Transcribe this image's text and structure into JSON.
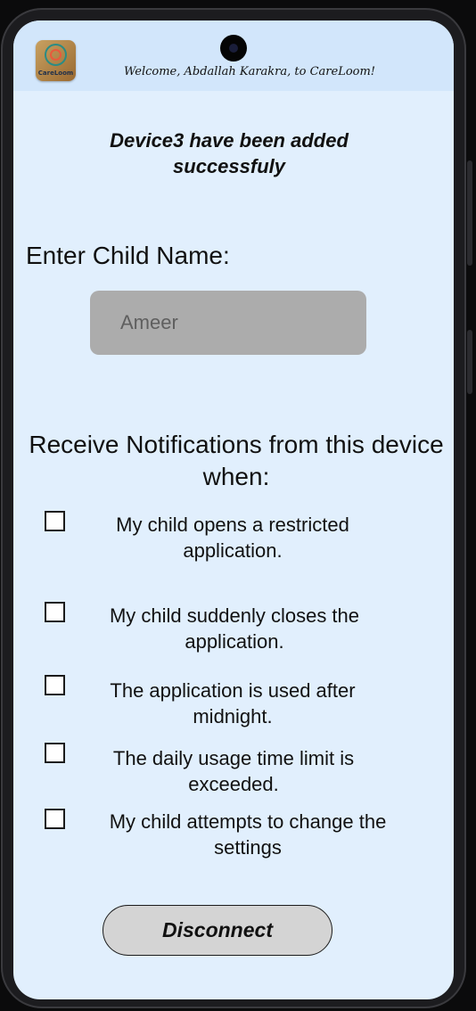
{
  "header": {
    "logo_text": "CareLoom",
    "welcome": "Welcome, Abdallah Karakra, to CareLoom!"
  },
  "main": {
    "success_message": "Device3 have been added successfuly",
    "child_name_label": "Enter Child Name:",
    "child_name_value": "Ameer",
    "notifications_title": "Receive Notifications from this device when:",
    "options": [
      {
        "label": "My child opens a restricted application.",
        "checked": false
      },
      {
        "label": "My child suddenly closes the application.",
        "checked": false
      },
      {
        "label": "The application is used after midnight.",
        "checked": false
      },
      {
        "label": "The daily usage time limit is exceeded.",
        "checked": false
      },
      {
        "label": "My child attempts to change the settings",
        "checked": false
      }
    ],
    "disconnect_label": "Disconnect"
  },
  "colors": {
    "screen_bg": "#e1effd",
    "header_bg": "#d2e6fb",
    "input_bg": "#acacac",
    "button_bg": "#d4d4d4"
  },
  "icons": [
    "careloom-logo-icon",
    "front-camera-icon",
    "checkbox-icon"
  ]
}
